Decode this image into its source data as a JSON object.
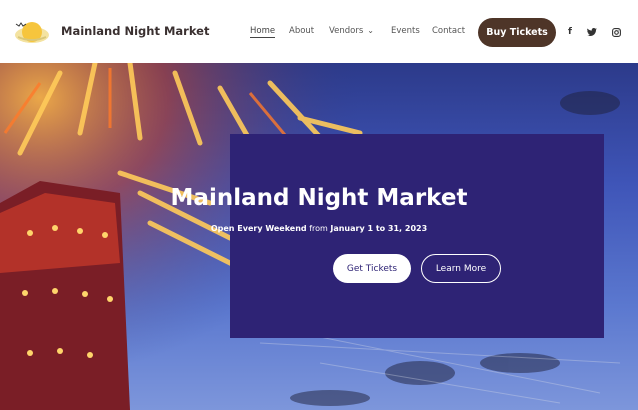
{
  "header": {
    "brand": "Mainland Night Market",
    "nav": {
      "home": "Home",
      "about": "About",
      "vendors": "Vendors",
      "events": "Events",
      "contact": "Contact"
    },
    "buy_tickets": "Buy Tickets",
    "social": {
      "facebook": "f",
      "twitter": "t",
      "instagram": "◎"
    }
  },
  "hero": {
    "title": "Mainland Night Market",
    "subtitle_pre": "Open Every Weekend",
    "subtitle_mid": " from ",
    "subtitle_dates": "January 1 to 31, 2023",
    "get_tickets": "Get Tickets",
    "learn_more": "Learn More"
  },
  "colors": {
    "panel": "#2e2375",
    "buy_button": "#4e3528"
  }
}
